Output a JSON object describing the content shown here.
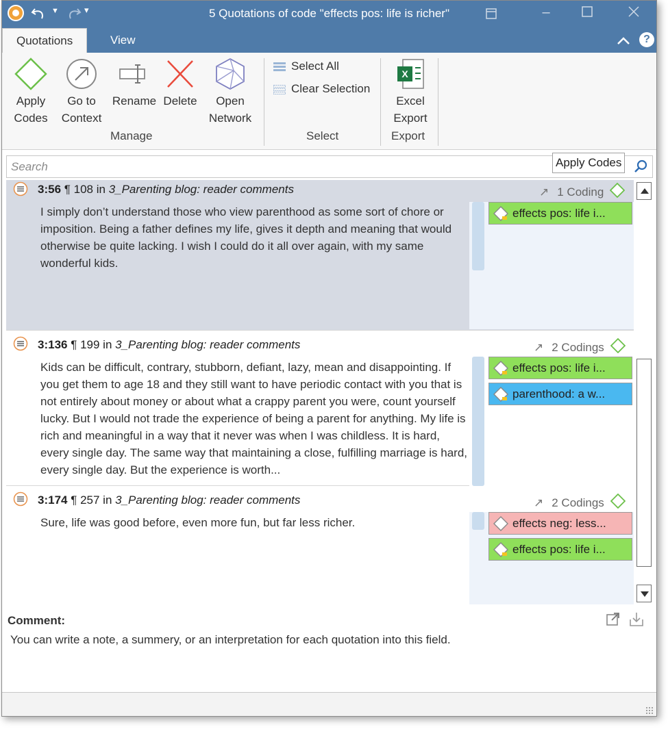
{
  "window": {
    "title": "5 Quotations of code \"effects pos: life is richer\""
  },
  "tabs": [
    {
      "label": "Quotations"
    },
    {
      "label": "View"
    }
  ],
  "ribbon": {
    "manage": {
      "apply_codes": "Apply\nCodes",
      "go_to_context": "Go to\nContext",
      "rename": "Rename",
      "delete": "Delete",
      "open_network": "Open\nNetwork",
      "group_label": "Manage"
    },
    "select": {
      "select_all": "Select All",
      "clear_selection": "Clear Selection",
      "group_label": "Select"
    },
    "export": {
      "excel_export": "Excel\nExport",
      "group_label": "Export"
    }
  },
  "search": {
    "placeholder": "Search",
    "tooltip": "Apply Codes"
  },
  "quotations": [
    {
      "id": "3:56",
      "paragraph": "¶ 108",
      "in": "in",
      "document": "3_Parenting blog: reader comments",
      "coding_count": "1 Coding",
      "text": "I simply don’t understand those who view parenthood as some sort of chore or imposition. Being a father defines my life, gives it depth and meaning that would otherwise be quite lacking. I wish I could do it all over again, with my same wonderful kids.",
      "codes": [
        {
          "label": "effects pos: life i...",
          "color": "#8fdf5a"
        }
      ]
    },
    {
      "id": "3:136",
      "paragraph": "¶ 199",
      "in": "in",
      "document": "3_Parenting blog: reader comments",
      "coding_count": "2 Codings",
      "text": "Kids can be difficult, contrary, stubborn, defiant, lazy, mean and disappointing. If you get them to age 18 and they still want to have periodic contact with you that is not entirely about money or about what a crappy parent you were, count yourself lucky. But I would not trade the experience of being a parent for anything. My life is rich and meaningful in a way that it never was when I was childless. It is hard, every single day. The same way that maintaining a close, fulfilling marriage is hard, every single day. But the experience is worth...",
      "codes": [
        {
          "label": "effects pos: life i...",
          "color": "#8fdf5a"
        },
        {
          "label": "parenthood: a w...",
          "color": "#4ab8f0"
        }
      ]
    },
    {
      "id": "3:174",
      "paragraph": "¶ 257",
      "in": "in",
      "document": "3_Parenting blog: reader comments",
      "coding_count": "2 Codings",
      "text": "Sure, life was good before, even more fun, but far less richer.",
      "codes": [
        {
          "label": "effects neg: less...",
          "color": "#f6b5b5"
        },
        {
          "label": "effects pos: life i...",
          "color": "#8fdf5a"
        }
      ]
    }
  ],
  "comment": {
    "label": "Comment:",
    "text": "You can write a note, a summery, or an interpretation for each quotation into this field."
  },
  "icons": {
    "app": "atlas-ti-icon",
    "undo": "undo-icon",
    "redo": "redo-icon",
    "quick_access": "customize-toolbar-icon",
    "minimize_ribbon": "chevron-up-icon",
    "help": "help-icon"
  }
}
